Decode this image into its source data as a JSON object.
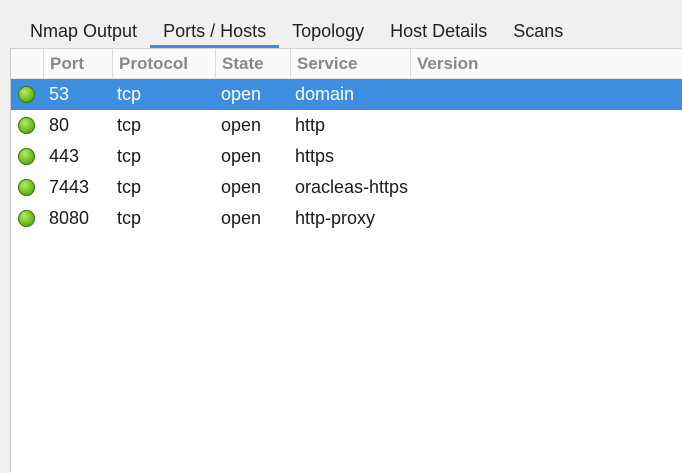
{
  "tabs": [
    {
      "label": "Nmap Output",
      "active": false
    },
    {
      "label": "Ports / Hosts",
      "active": true
    },
    {
      "label": "Topology",
      "active": false
    },
    {
      "label": "Host Details",
      "active": false
    },
    {
      "label": "Scans",
      "active": false
    }
  ],
  "table": {
    "columns": {
      "port": "Port",
      "protocol": "Protocol",
      "state": "State",
      "service": "Service",
      "version": "Version"
    },
    "status_icon": "green-status-dot-icon",
    "selected_color": "#3d8ee0",
    "rows": [
      {
        "port": "53",
        "protocol": "tcp",
        "state": "open",
        "service": "domain",
        "version": "",
        "selected": true
      },
      {
        "port": "80",
        "protocol": "tcp",
        "state": "open",
        "service": "http",
        "version": "",
        "selected": false
      },
      {
        "port": "443",
        "protocol": "tcp",
        "state": "open",
        "service": "https",
        "version": "",
        "selected": false
      },
      {
        "port": "7443",
        "protocol": "tcp",
        "state": "open",
        "service": "oracleas-https",
        "version": "",
        "selected": false
      },
      {
        "port": "8080",
        "protocol": "tcp",
        "state": "open",
        "service": "http-proxy",
        "version": "",
        "selected": false
      }
    ]
  }
}
